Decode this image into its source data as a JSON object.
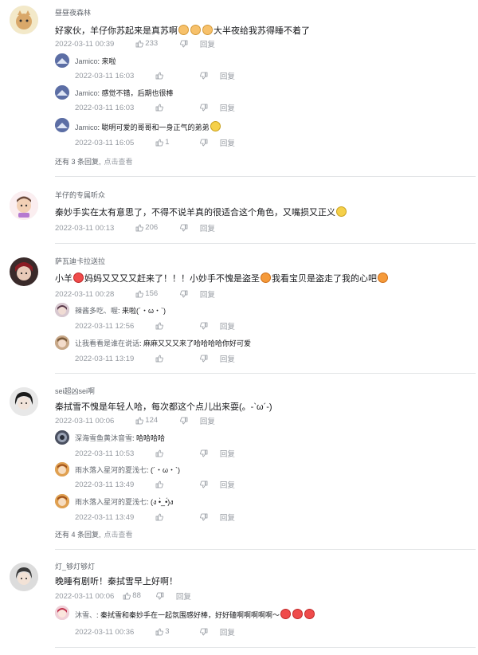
{
  "labels": {
    "reply": "回复"
  },
  "comments": [
    {
      "user": "昼昼夜森林",
      "text_parts": [
        "好家伙，羊仔你苏起来是真苏啊",
        "大半夜给我苏得睡不着了"
      ],
      "time": "2022-03-11 00:39",
      "likes": "233",
      "replies": [
        {
          "user": "Jamico",
          "text": ": 来啦",
          "time": "2022-03-11 16:03",
          "likes": ""
        },
        {
          "user": "Jamico",
          "text": ": 感觉不错，后期也很棒",
          "time": "2022-03-11 16:03",
          "likes": ""
        },
        {
          "user": "Jamico",
          "text": ": 聪明可爱的哥哥和一身正气的弟弟",
          "time": "2022-03-11 16:05",
          "likes": "1"
        }
      ],
      "more": {
        "text": "还有 3 条回复,",
        "link": "点击查看"
      }
    },
    {
      "user": "羊仔的专属听众",
      "text_parts": [
        "秦妙手实在太有意思了，不得不说羊真的很适合这个角色，又嘴损又正义",
        ""
      ],
      "time": "2022-03-11 00:13",
      "likes": "206",
      "replies": []
    },
    {
      "user": "萨瓦迪卡拉送拉",
      "text_parts": [
        "小羊",
        "妈妈又又又又赶来了！！！小妙手不愧是盗圣",
        "我看宝贝是盗走了我的心吧",
        ""
      ],
      "time": "2022-03-11 00:28",
      "likes": "156",
      "replies": [
        {
          "user": "辣酱多吃、喔",
          "text": ": 来啦(´・ω・`)",
          "time": "2022-03-11 12:56",
          "likes": ""
        },
        {
          "user": "让我看看是谁在说话",
          "text": ": 麻麻又又又来了哈哈哈哈你好可爱",
          "time": "2022-03-11 13:19",
          "likes": ""
        }
      ]
    },
    {
      "user": "sei超凶sei啊",
      "text_parts": [
        "秦拭雪不愧是年轻人哈，每次都这个点儿出来耍(。-`ω´-)"
      ],
      "time": "2022-03-11 00:06",
      "likes": "124",
      "replies": [
        {
          "user": "深海雪鱼黄沐音雪",
          "text": ": 哈哈哈哈",
          "time": "2022-03-11 10:53",
          "likes": ""
        },
        {
          "user": "雨水落入星河的夏浅七",
          "text": ": (´・ω・`)",
          "time": "2022-03-11 13:49",
          "likes": ""
        },
        {
          "user": "雨水落入星河的夏浅七",
          "text": ": (ง •̀_•́)ง",
          "time": "2022-03-11 13:49",
          "likes": ""
        }
      ],
      "more": {
        "text": "还有 4 条回复,",
        "link": "点击查看"
      }
    },
    {
      "user": "灯_够灯够灯",
      "text_parts": [
        "晚睡有剧听！秦拭雪早上好啊！"
      ],
      "time": "2022-03-11 00:06",
      "likes": "88",
      "replies": [
        {
          "user": "沐雪、",
          "text": ": 秦拭雪和秦妙手在一起氛围感好棒，好好磕啊啊啊啊啊～",
          "time": "2022-03-11 00:36",
          "likes": "3"
        }
      ]
    }
  ]
}
